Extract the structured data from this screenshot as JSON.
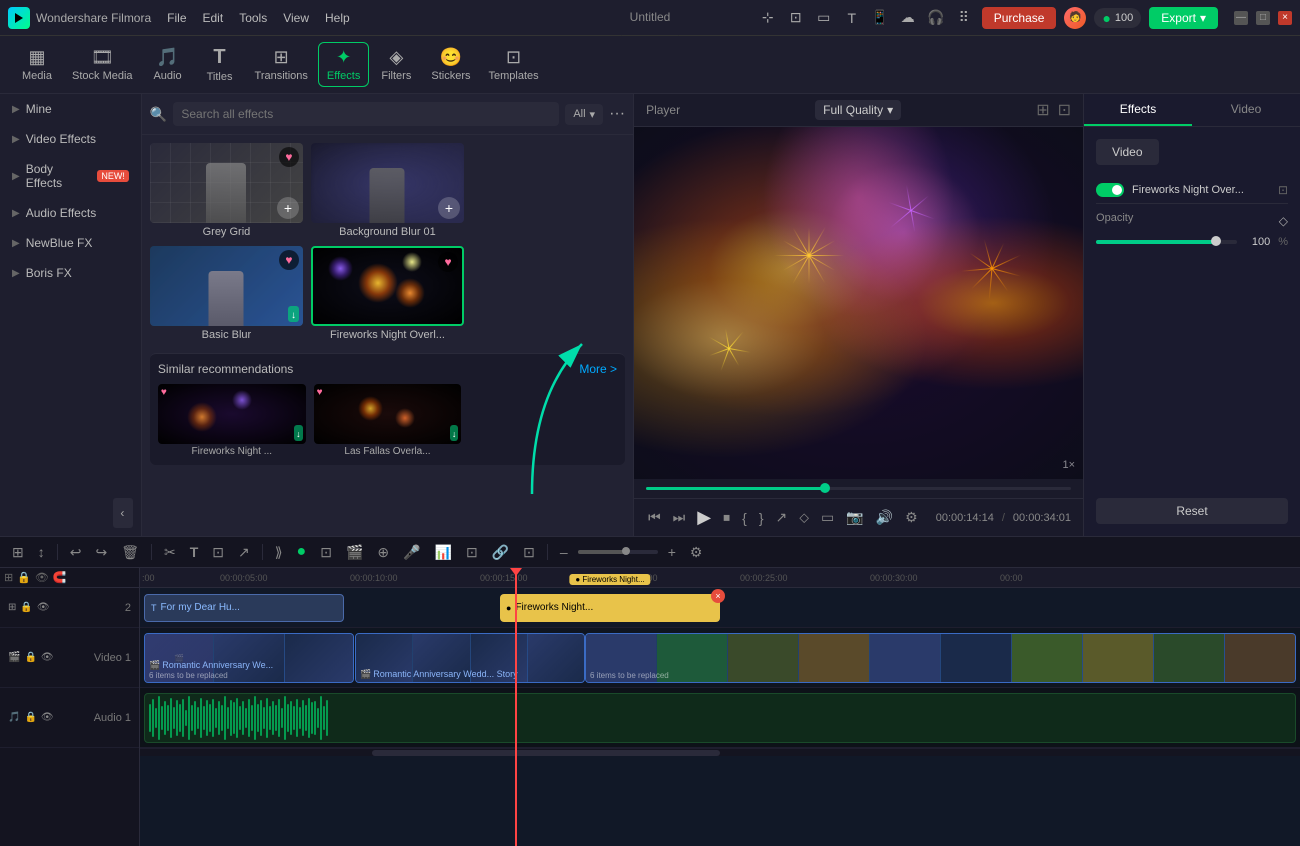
{
  "app": {
    "name": "Wondershare Filmora",
    "title": "Untitled",
    "logo_text": "W"
  },
  "titlebar": {
    "menu": [
      "File",
      "Edit",
      "Tools",
      "View",
      "Help"
    ],
    "purchase_label": "Purchase",
    "export_label": "Export",
    "coins": "100",
    "window_controls": [
      "–",
      "□",
      "×"
    ]
  },
  "toolbar": {
    "items": [
      {
        "id": "media",
        "label": "Media",
        "icon": "▦"
      },
      {
        "id": "stock",
        "label": "Stock Media",
        "icon": "🎬"
      },
      {
        "id": "audio",
        "label": "Audio",
        "icon": "♪"
      },
      {
        "id": "titles",
        "label": "Titles",
        "icon": "T"
      },
      {
        "id": "transitions",
        "label": "Transitions",
        "icon": "⊞"
      },
      {
        "id": "effects",
        "label": "Effects",
        "icon": "✦",
        "active": true
      },
      {
        "id": "filters",
        "label": "Filters",
        "icon": "◈"
      },
      {
        "id": "stickers",
        "label": "Stickers",
        "icon": "😊"
      },
      {
        "id": "templates",
        "label": "Templates",
        "icon": "⊡"
      }
    ]
  },
  "sidebar": {
    "items": [
      {
        "label": "Mine",
        "id": "mine"
      },
      {
        "label": "Video Effects",
        "id": "video-effects"
      },
      {
        "label": "Body Effects",
        "id": "body-effects",
        "badge": "NEW!"
      },
      {
        "label": "Audio Effects",
        "id": "audio-effects"
      },
      {
        "label": "NewBlue FX",
        "id": "newblue-fx"
      },
      {
        "label": "Boris FX",
        "id": "boris-fx"
      }
    ]
  },
  "effects": {
    "search_placeholder": "Search all effects",
    "filter_label": "All",
    "grid_items": [
      {
        "id": "grey-grid",
        "label": "Grey Grid",
        "has_heart": true
      },
      {
        "id": "background-blur-01",
        "label": "Background Blur 01",
        "has_heart": false
      },
      {
        "id": "basic-blur",
        "label": "Basic Blur",
        "has_heart": true
      },
      {
        "id": "fireworks-night",
        "label": "Fireworks Night Overl...",
        "has_heart": true,
        "selected": true
      }
    ],
    "recommendations_label": "Similar recommendations",
    "more_label": "More >",
    "rec_items": [
      {
        "id": "fireworks-night-2",
        "label": "Fireworks Night ..."
      },
      {
        "id": "las-fallas",
        "label": "Las Fallas Overla..."
      }
    ]
  },
  "preview": {
    "player_label": "Player",
    "quality_label": "Full Quality",
    "timestamp": "1×",
    "current_time": "00:00:14:14",
    "total_time": "00:00:34:01",
    "progress_percent": 42
  },
  "right_panel": {
    "tabs": [
      "Effects",
      "Video"
    ],
    "active_tab": "Effects",
    "video_tab_label": "Video",
    "effect_name": "Fireworks Night Over...",
    "opacity_label": "Opacity",
    "opacity_value": "100",
    "opacity_percent": "%",
    "reset_label": "Reset"
  },
  "timeline": {
    "toolbar_icons": [
      "⊞",
      "↕",
      "↩",
      "↪",
      "🗑",
      "✂",
      "T",
      "⊡",
      "↗",
      "⊞",
      "⟳",
      "⟫",
      "●",
      "⊡",
      "🎬",
      "⭕",
      "🎤",
      "📊",
      "⊡",
      "🔗",
      "⊡",
      "⊡",
      "⊡",
      "–",
      "+"
    ],
    "rulers": [
      "00:00",
      "00:00:05:00",
      "00:00:10:00",
      "00:00:15:00",
      "00:00:20:00",
      "00:00:25:00",
      "00:00:30:00"
    ],
    "tracks": [
      {
        "id": "track-2",
        "label": "2",
        "name": ""
      },
      {
        "id": "track-video-1",
        "label": "Video 1",
        "name": ""
      },
      {
        "id": "track-audio-1",
        "label": "Audio 1",
        "name": ""
      }
    ],
    "clips": [
      {
        "id": "for-my-dear",
        "label": "For my Dear Hu...",
        "type": "title",
        "track": 0
      },
      {
        "id": "fireworks-night-clip",
        "label": "Fireworks Night...",
        "type": "fireworks",
        "track": 0
      },
      {
        "id": "romantic-we-1",
        "label": "Romantic Anniversary We...",
        "type": "video",
        "track": 1,
        "sub": "6 items to be replaced"
      },
      {
        "id": "romantic-we-2",
        "label": "Romantic Anniversary Wedd...",
        "type": "video",
        "track": 1,
        "sub": "Story"
      },
      {
        "id": "romantic-we-3",
        "label": "",
        "type": "video-frag",
        "track": 1,
        "sub": "6 items to be replaced"
      }
    ]
  }
}
